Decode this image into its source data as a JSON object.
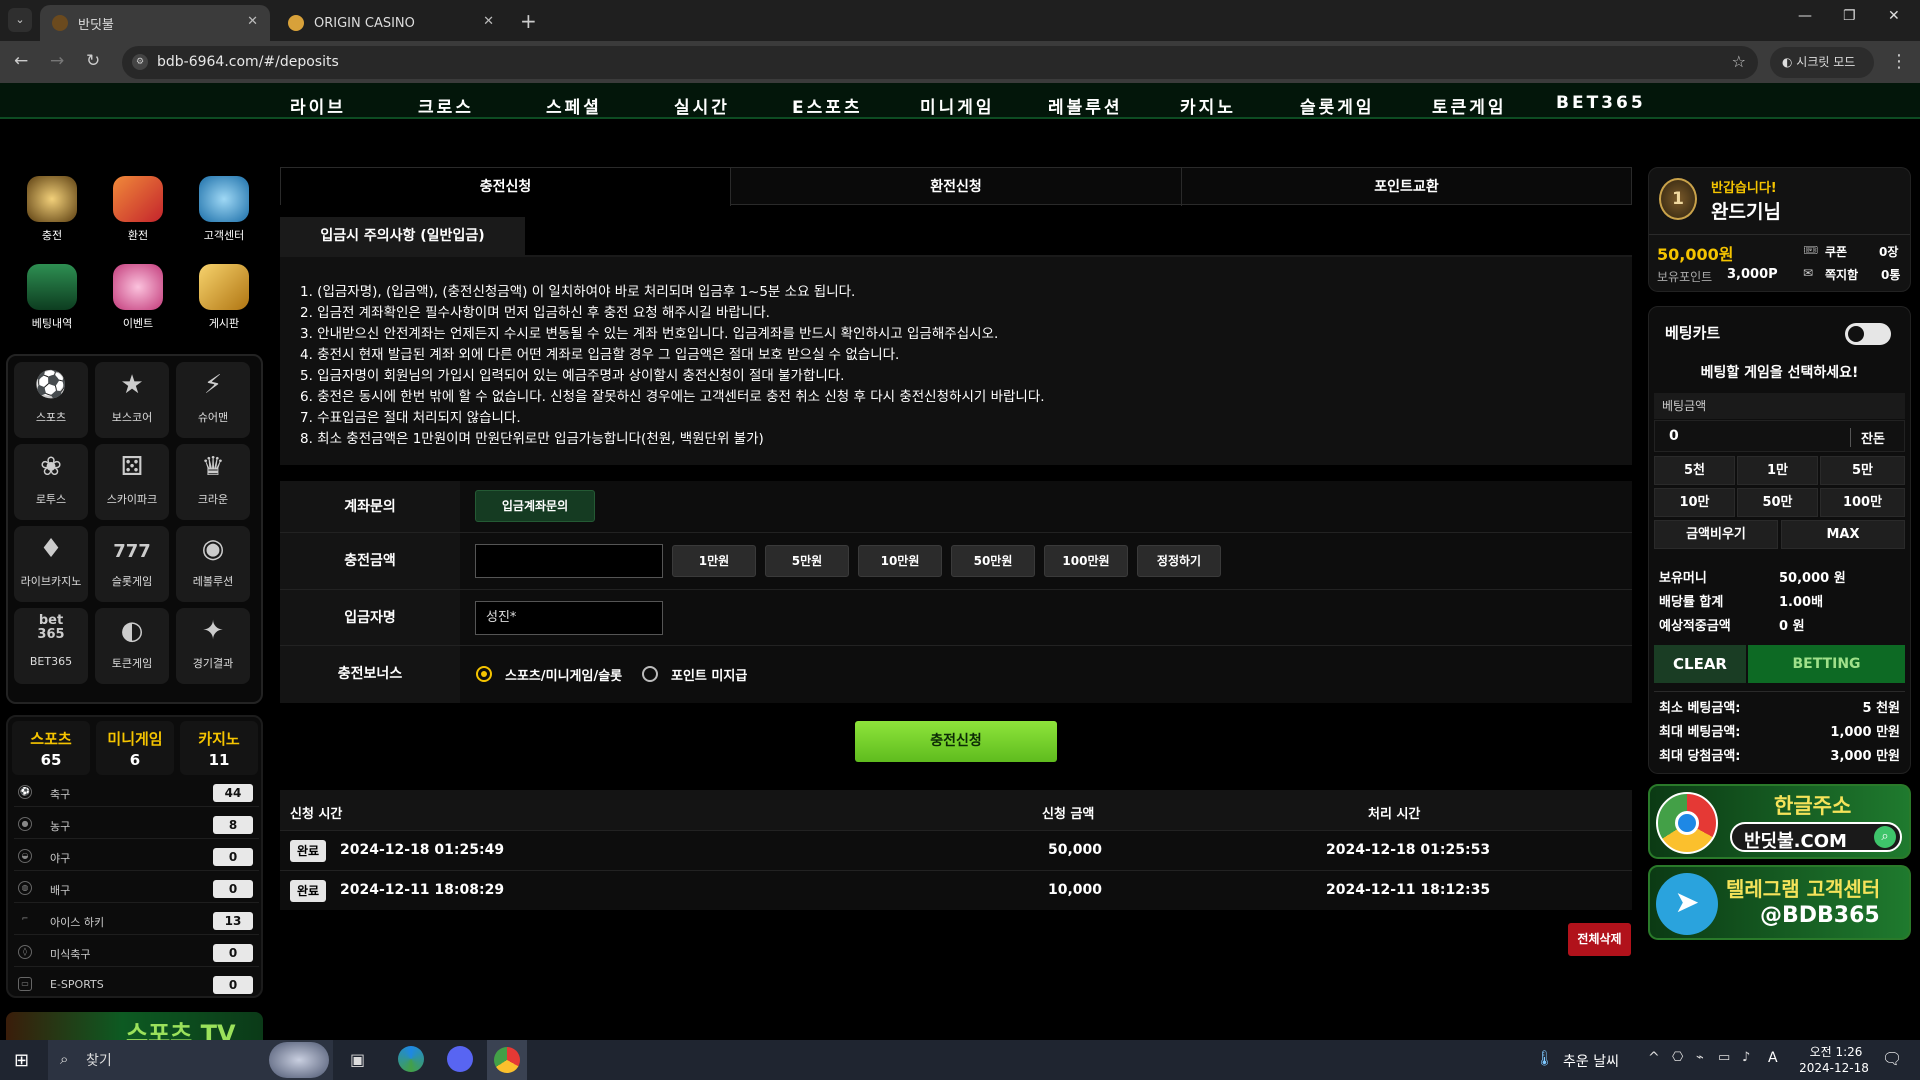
{
  "browser": {
    "tabs": [
      {
        "label": "반딧불",
        "active": true
      },
      {
        "label": "ORIGIN CASINO",
        "active": false
      }
    ],
    "url": "bdb-6964.com/#/deposits",
    "incognito_label": "시크릿 모드"
  },
  "topnav": [
    "라이브",
    "크로스",
    "스페셜",
    "실시간",
    "E스포츠",
    "미니게임",
    "레볼루션",
    "카지노",
    "슬롯게임",
    "토큰게임",
    "BET365"
  ],
  "quick_menu": [
    {
      "label": "충전",
      "icon": "coin-icon",
      "color": "#d9a94b"
    },
    {
      "label": "환전",
      "icon": "card-icon",
      "color": "#e0553a"
    },
    {
      "label": "고객센터",
      "icon": "chat-bubble-icon",
      "color": "#3fa6e0"
    },
    {
      "label": "베팅내역",
      "icon": "bar-chart-icon",
      "color": "#3ec46a"
    },
    {
      "label": "이벤트",
      "icon": "heart-icon",
      "color": "#f07ab2"
    },
    {
      "label": "게시판",
      "icon": "board-icon",
      "color": "#e8b34a"
    }
  ],
  "games": [
    {
      "label": "스포츠",
      "icon": "soccer-ball-icon",
      "glyph": "⚽"
    },
    {
      "label": "보스코어",
      "icon": "star-icon",
      "glyph": "★"
    },
    {
      "label": "슈어맨",
      "icon": "man-icon",
      "glyph": "⚡"
    },
    {
      "label": "로투스",
      "icon": "lotus-icon",
      "glyph": "❀"
    },
    {
      "label": "스카이파크",
      "icon": "dice-icon",
      "glyph": "⚄"
    },
    {
      "label": "크라운",
      "icon": "crown-icon",
      "glyph": "♛"
    },
    {
      "label": "라이브카지노",
      "icon": "cards-icon",
      "glyph": "♦"
    },
    {
      "label": "슬롯게임",
      "icon": "slot-777-icon",
      "glyph": "777"
    },
    {
      "label": "레볼루션",
      "icon": "chip-icon",
      "glyph": "◉"
    },
    {
      "label": "BET365",
      "icon": "bet365-logo-icon",
      "glyph": "bet\n365"
    },
    {
      "label": "토큰게임",
      "icon": "token-ring-icon",
      "glyph": "◐"
    },
    {
      "label": "경기결과",
      "icon": "trophy-icon",
      "glyph": "✦"
    }
  ],
  "counts": [
    {
      "label": "스포츠",
      "count": "65"
    },
    {
      "label": "미니게임",
      "count": "6"
    },
    {
      "label": "카지노",
      "count": "11"
    }
  ],
  "sports": [
    {
      "name": "축구",
      "count": "44"
    },
    {
      "name": "농구",
      "count": "8"
    },
    {
      "name": "야구",
      "count": "0"
    },
    {
      "name": "배구",
      "count": "0"
    },
    {
      "name": "아이스 하키",
      "count": "13"
    },
    {
      "name": "미식축구",
      "count": "0"
    },
    {
      "name": "E-SPORTS",
      "count": "0"
    }
  ],
  "sports_tv": "스포츠 TV",
  "main_tabs": [
    "충전신청",
    "환전신청",
    "포인트교환"
  ],
  "notice_title": "입금시 주의사항 (일반입금)",
  "notices": [
    "1. (입금자명), (입금액), (충전신청금액) 이 일치하여야 바로 처리되며 입금후 1~5분 소요 됩니다.",
    "2. 입금전 계좌확인은 필수사항이며 먼저 입금하신 후 충전 요청 해주시길 바랍니다.",
    "3. 안내받으신 안전계좌는 언제든지 수시로 변동될 수 있는 계좌 번호입니다. 입금계좌를 반드시 확인하시고 입금해주십시오.",
    "4. 충전시 현재 발급된 계좌 외에 다른 어떤 계좌로 입금할 경우 그 입금액은 절대 보호 받으실 수 없습니다.",
    "5. 입금자명이 회원님의 가입시 입력되어 있는 예금주명과 상이할시 충전신청이 절대 불가합니다.",
    "6. 충전은 동시에 한번 밖에 할 수 없습니다. 신청을 잘못하신 경우에는 고객센터로 충전 취소 신청 후 다시 충전신청하시기 바랍니다.",
    "7. 수표입금은 절대 처리되지 않습니다.",
    "8. 최소 충전금액은 1만원이며 만원단위로만 입금가능합니다(천원, 백원단위 불가)"
  ],
  "form": {
    "account_label": "계좌문의",
    "account_button": "입금계좌문의",
    "amount_label": "충전금액",
    "amount_value": "",
    "amount_buttons": [
      "1만원",
      "5만원",
      "10만원",
      "50만원",
      "100만원",
      "정정하기"
    ],
    "depositor_label": "입금자명",
    "depositor_value": "성진*",
    "bonus_label": "충전보너스",
    "bonus_options": [
      {
        "label": "스포츠/미니게임/슬롯",
        "selected": true
      },
      {
        "label": "포인트 미지급",
        "selected": false
      }
    ],
    "submit": "충전신청"
  },
  "history": {
    "headers": [
      "신청 시간",
      "신청 금액",
      "처리 시간"
    ],
    "rows": [
      {
        "status": "완료",
        "request_time": "2024-12-18 01:25:49",
        "amount": "50,000",
        "processed_time": "2024-12-18 01:25:53"
      },
      {
        "status": "완료",
        "request_time": "2024-12-11 18:08:29",
        "amount": "10,000",
        "processed_time": "2024-12-11 18:12:35"
      }
    ],
    "delete_all": "전체삭제"
  },
  "profile": {
    "level": "1",
    "greeting": "반갑습니다!",
    "name": "완드기님",
    "money": "50,000원",
    "points_label": "보유포인트",
    "points": "3,000P",
    "coupon_label": "쿠폰",
    "coupon": "0장",
    "message_label": "쪽지함",
    "message": "0통"
  },
  "betcart": {
    "title": "베팅카트",
    "toggle_on": false,
    "prompt": "베팅할 게임을 선택하세요!",
    "amount_label": "베팅금액",
    "amount": "0",
    "remainder": "잔돈",
    "quick": [
      "5천",
      "1만",
      "5만",
      "10만",
      "50만",
      "100만"
    ],
    "clear_amount": "금액비우기",
    "max": "MAX",
    "stats": [
      {
        "label": "보유머니",
        "value": "50,000 원"
      },
      {
        "label": "배당률 합계",
        "value": "1.00배"
      },
      {
        "label": "예상적중금액",
        "value": "0 원"
      }
    ],
    "clear": "CLEAR",
    "betting": "BETTING",
    "limits": [
      {
        "label": "최소 베팅금액:",
        "value": "5 천원"
      },
      {
        "label": "최대 베팅금액:",
        "value": "1,000 만원"
      },
      {
        "label": "최대 당첨금액:",
        "value": "3,000 만원"
      }
    ]
  },
  "banners": {
    "korean_addr_title": "한글주소",
    "korean_addr": "반딧불.COM",
    "telegram_title": "텔레그램 고객센터",
    "telegram_id": "@BDB365"
  },
  "taskbar": {
    "search_placeholder": "찾기",
    "weather": "추운 날씨",
    "ime": "A",
    "time": "오전 1:26",
    "date": "2024-12-18"
  },
  "colors": {
    "accent_yellow": "#f5c400",
    "accent_green": "#6fd12b",
    "danger": "#b1121b"
  }
}
